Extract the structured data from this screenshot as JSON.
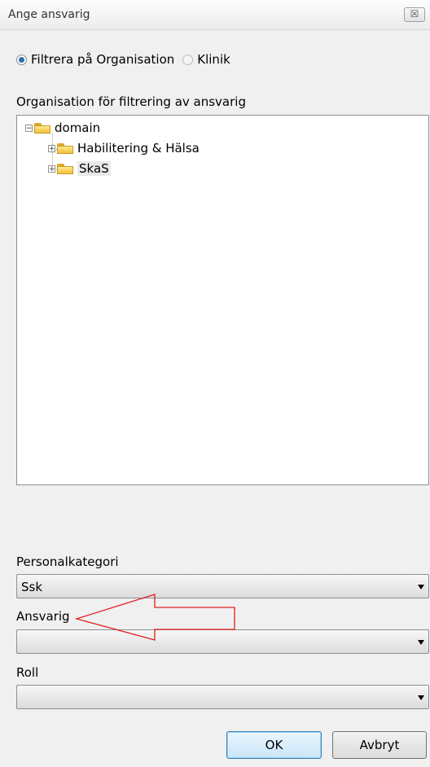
{
  "window": {
    "title": "Ange ansvarig",
    "close_glyph": "☒"
  },
  "filter": {
    "options": [
      {
        "label": "Filtrera på Organisation",
        "selected": true
      },
      {
        "label": "Klinik",
        "selected": false
      }
    ]
  },
  "tree": {
    "label": "Organisation för filtrering av ansvarig",
    "root": {
      "label": "domain",
      "expanded": true
    },
    "children": [
      {
        "label": "Habilitering & Hälsa",
        "expanded": false,
        "selected": false
      },
      {
        "label": "SkaS",
        "expanded": false,
        "selected": true
      }
    ]
  },
  "fields": {
    "personalkategori": {
      "label": "Personalkategori",
      "value": "Ssk"
    },
    "ansvarig": {
      "label": "Ansvarig",
      "value": ""
    },
    "roll": {
      "label": "Roll",
      "value": ""
    }
  },
  "annotation": {
    "color": "#e02020"
  },
  "buttons": {
    "ok": "OK",
    "cancel": "Avbryt"
  }
}
